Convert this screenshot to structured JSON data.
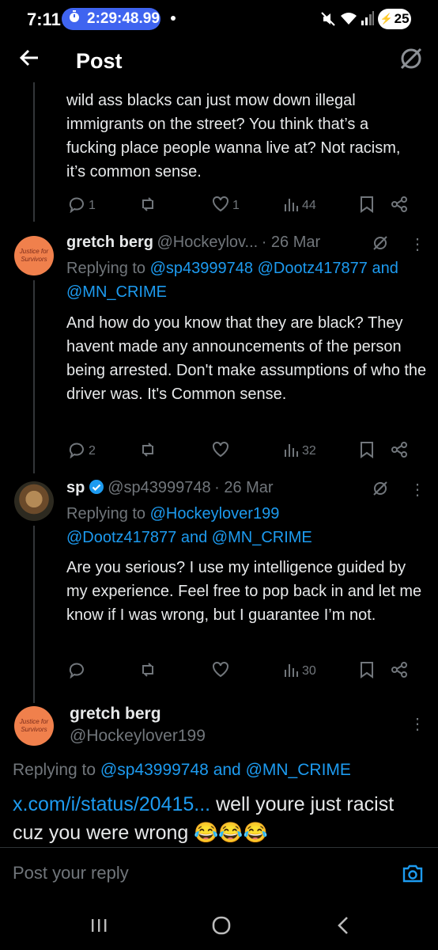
{
  "status_bar": {
    "time": "7:11",
    "timer": "2:29:48.99",
    "battery": "25"
  },
  "header": {
    "title": "Post"
  },
  "tweets": [
    {
      "body": "wild ass blacks can just mow down illegal immigrants on the street? You think that’s a fucking place people wanna live at?  Not racism, it’s common sense.",
      "replies": "1",
      "reposts": "",
      "likes": "1",
      "views": "44"
    },
    {
      "name": "gretch berg",
      "handle": "@Hockeylov...",
      "date": "· 26 Mar",
      "avatar_text": "Justice for Survivors",
      "replying_label": "Replying to",
      "mentions": [
        "@sp43999748",
        "@Dootz417877",
        "@MN_CRIME"
      ],
      "and": "and",
      "body": "And how do you know that they are black? They havent made any announcements of the person being arrested. Don't make assumptions of who the driver was. It's Common sense.",
      "replies": "2",
      "reposts": "",
      "likes": "",
      "views": "32"
    },
    {
      "name": "sp",
      "handle": "@sp43999748",
      "date": "· 26 Mar",
      "verified": true,
      "replying_label": "Replying to",
      "mentions": [
        "@Hockeylover199",
        "@Dootz417877",
        "@MN_CRIME"
      ],
      "and": "and",
      "body": "Are you serious?  I use my intelligence guided by my experience. Feel free to pop back in and let me know if I was wrong, but I guarantee I’m not.",
      "replies": "",
      "reposts": "",
      "likes": "",
      "views": "30"
    }
  ],
  "main_post": {
    "name": "gretch berg",
    "handle": "@Hockeylover199",
    "avatar_text": "Justice for Survivors",
    "replying_label": "Replying to",
    "mentions": [
      "@sp43999748",
      "@MN_CRIME"
    ],
    "and": "and",
    "link": "x.com/i/status/20415...",
    "text": " well youre just racist cuz you were wrong 😂😂😂"
  },
  "reply_box": {
    "placeholder": "Post your reply"
  },
  "colors": {
    "accent": "#1d9bf0",
    "muted": "#71767b",
    "timer_pill": "#3f64f0"
  }
}
